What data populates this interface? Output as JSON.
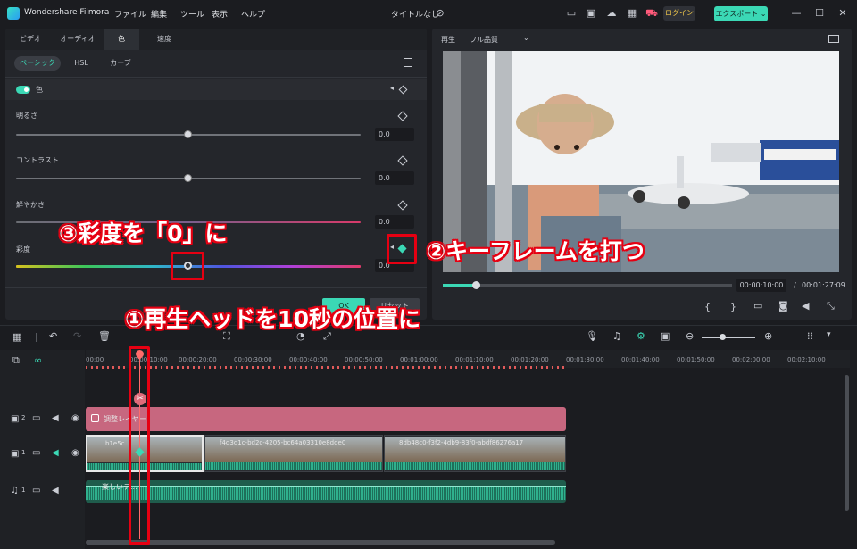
{
  "app": {
    "title": "Wondershare Filmora",
    "menu": [
      "ファイル",
      "編集",
      "ツール",
      "表示",
      "ヘルプ"
    ],
    "project_title": "タイトルなし",
    "login_label": "ログイン",
    "export_label": "エクスポート ⌄"
  },
  "left_panel": {
    "tabs": [
      "ビデオ",
      "オーディオ",
      "色",
      "速度"
    ],
    "active_tab": "色",
    "subtabs": [
      "ベーシック",
      "HSL",
      "カーブ"
    ],
    "active_subtab": "ベーシック",
    "section_label": "色",
    "sliders": [
      {
        "label": "明るさ",
        "value": "0.0",
        "level": 0.5
      },
      {
        "label": "コントラスト",
        "value": "0.0",
        "level": 0.5
      },
      {
        "label": "鮮やかさ",
        "value": "0.0",
        "level": 0.5
      },
      {
        "label": "彩度",
        "value": "0.0",
        "level": 0.5
      }
    ],
    "bottom_buttons": [
      "OK",
      "リセット"
    ]
  },
  "preview": {
    "label": "再生",
    "quality": "フル品質",
    "current_time": "00:00:10:00",
    "separator": "/",
    "total_time": "00:01:27:09",
    "progress": 0.115
  },
  "timeline": {
    "ruler": [
      "00:00",
      "00:00:10:00",
      "00:00:20:00",
      "00:00:30:00",
      "00:00:40:00",
      "00:00:50:00",
      "00:01:00:00",
      "00:01:10:00",
      "00:01:20:00",
      "00:01:30:00",
      "00:01:40:00",
      "00:01:50:00",
      "00:02:00:00",
      "00:02:10:00"
    ],
    "tracks": {
      "track2_label": "2",
      "track1_label": "1",
      "audio_label": "1"
    },
    "adjustment_clip": "調整レイヤー",
    "video_clips": [
      "b1e5c...",
      "f4d3d1c-bd2c-4205-bc64a03310e8dde0",
      "8db48c0-f3f2-4db9-83f0-abdf86276a17"
    ],
    "audio_clip": "楽しいテ..."
  },
  "annotations": {
    "step1": "①再生ヘッドを10秒の位置に",
    "step2": "②キーフレームを打つ",
    "step3": "③彩度を「0」に"
  },
  "colors": {
    "accent": "#3bd8b5",
    "annotation_red": "#e60012",
    "adjustment_layer": "#c7677f"
  }
}
